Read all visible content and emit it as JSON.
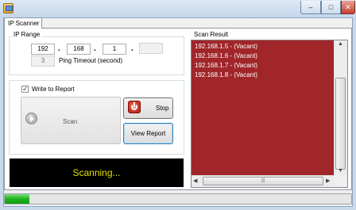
{
  "window": {
    "title": "",
    "controls": {
      "minimize": "–",
      "maximize": "□",
      "close": "✕"
    }
  },
  "tabs": [
    {
      "label": "IP Scanner"
    }
  ],
  "ip_range": {
    "label": "IP Range",
    "octets": [
      "192",
      "168",
      "1",
      ""
    ],
    "ping_timeout_value": "3",
    "ping_timeout_label": "Ping Timeout (second)"
  },
  "report": {
    "checkbox_label": "Write to Report",
    "checked": true
  },
  "buttons": {
    "scan": "Scan",
    "stop": "Stop",
    "view_report": "View Report"
  },
  "status": {
    "text": "Scanning...",
    "color": "#e4e000"
  },
  "scan_result": {
    "label": "Scan Result",
    "items": [
      "192.168.1.5 - (Vacant)",
      "192.168.1.6 - (Vacant)",
      "192.168.1.7 - (Vacant)",
      "192.168.1.8 - (Vacant)"
    ],
    "background": "#a0262a"
  },
  "progress": {
    "fraction": 0.07,
    "color": "#1eb41e"
  }
}
